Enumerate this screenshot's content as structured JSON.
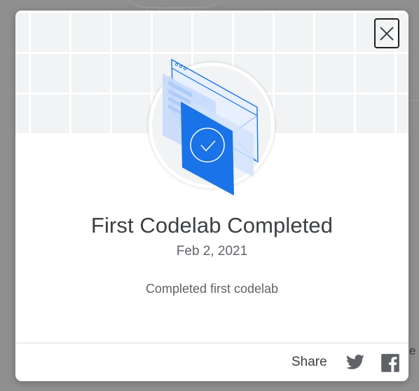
{
  "dialog": {
    "title": "First Codelab Completed",
    "date": "Feb 2, 2021",
    "description": "Completed first codelab",
    "close_icon": "close-icon",
    "badge_icon": "codelab-badge-icon"
  },
  "footer": {
    "share_label": "Share",
    "share_targets": [
      "twitter-icon",
      "facebook-icon"
    ]
  },
  "background": {
    "peek_text": "e"
  },
  "colors": {
    "badge_blue": "#1a73e8",
    "badge_light_blue": "#aecbfa",
    "header_bg": "#f1f3f4",
    "text_primary": "#3c4043",
    "text_secondary": "#5f6368",
    "overlay": "#8f8f8f"
  }
}
